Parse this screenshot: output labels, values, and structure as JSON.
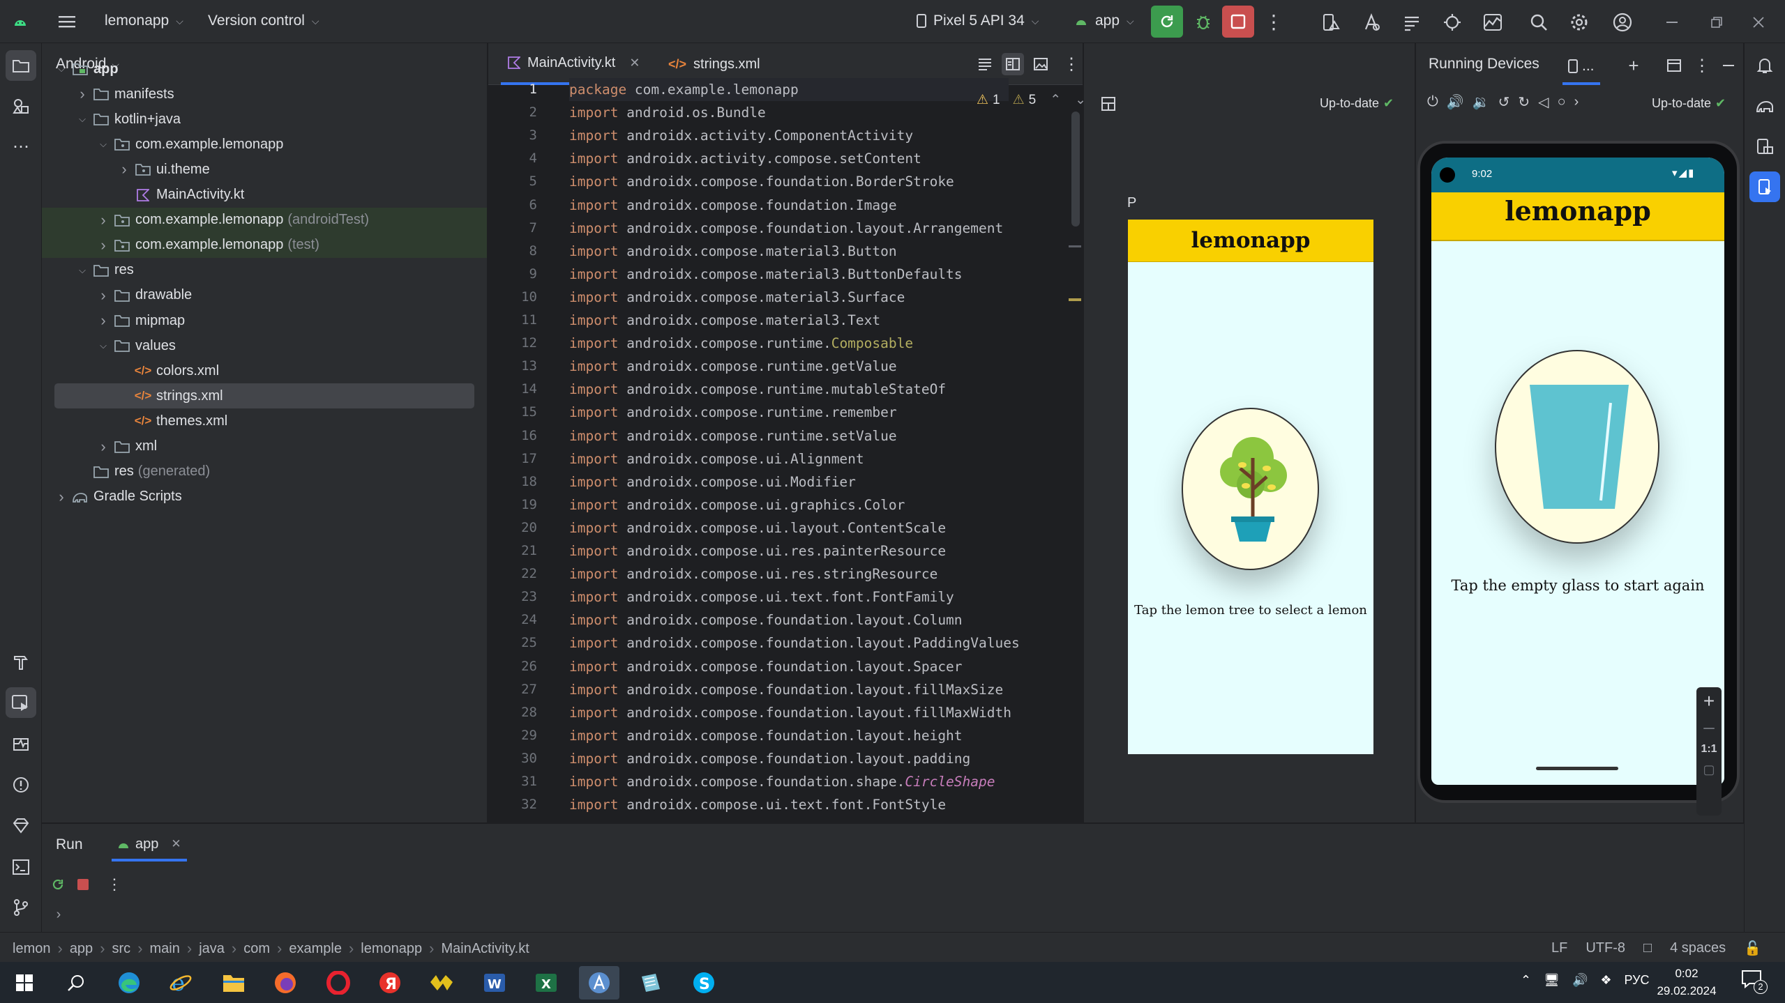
{
  "titlebar": {
    "project": "lemonapp",
    "vcs": "Version control",
    "device": "Pixel 5 API 34",
    "config": "app"
  },
  "project_panel": {
    "view": "Android",
    "tree": [
      {
        "label": "app",
        "depth": 0,
        "arrow": "open",
        "icon": "module",
        "bold": true
      },
      {
        "label": "manifests",
        "depth": 1,
        "arrow": "closed",
        "icon": "folder"
      },
      {
        "label": "kotlin+java",
        "depth": 1,
        "arrow": "open",
        "icon": "folder"
      },
      {
        "label": "com.example.lemonapp",
        "depth": 2,
        "arrow": "open",
        "icon": "package"
      },
      {
        "label": "ui.theme",
        "depth": 3,
        "arrow": "closed",
        "icon": "package"
      },
      {
        "label": "MainActivity.kt",
        "depth": 3,
        "arrow": "none",
        "icon": "kotlin"
      },
      {
        "label": "com.example.lemonapp",
        "suffix": "(androidTest)",
        "depth": 2,
        "arrow": "closed",
        "icon": "package",
        "green": true
      },
      {
        "label": "com.example.lemonapp",
        "suffix": "(test)",
        "depth": 2,
        "arrow": "closed",
        "icon": "package",
        "green": true
      },
      {
        "label": "res",
        "depth": 1,
        "arrow": "open",
        "icon": "folder"
      },
      {
        "label": "drawable",
        "depth": 2,
        "arrow": "closed",
        "icon": "folder"
      },
      {
        "label": "mipmap",
        "depth": 2,
        "arrow": "closed",
        "icon": "folder"
      },
      {
        "label": "values",
        "depth": 2,
        "arrow": "open",
        "icon": "folder"
      },
      {
        "label": "colors.xml",
        "depth": 3,
        "arrow": "none",
        "icon": "xml"
      },
      {
        "label": "strings.xml",
        "depth": 3,
        "arrow": "none",
        "icon": "xml",
        "selected": true
      },
      {
        "label": "themes.xml",
        "depth": 3,
        "arrow": "none",
        "icon": "xml"
      },
      {
        "label": "xml",
        "depth": 2,
        "arrow": "closed",
        "icon": "folder"
      },
      {
        "label": "res",
        "suffix": "(generated)",
        "depth": 1,
        "arrow": "none",
        "icon": "folder"
      },
      {
        "label": "Gradle Scripts",
        "depth": 0,
        "arrow": "closed",
        "icon": "gradle"
      }
    ]
  },
  "editor": {
    "tabs": [
      {
        "label": "MainActivity.kt",
        "active": true
      },
      {
        "label": "strings.xml",
        "active": false
      }
    ],
    "warnings": "1",
    "weak_warnings": "5",
    "lines": [
      [
        "package",
        " com.example.lemonapp"
      ],
      [
        "import",
        " android.os.Bundle"
      ],
      [
        "import",
        " androidx.activity.ComponentActivity"
      ],
      [
        "import",
        " androidx.activity.compose.setContent"
      ],
      [
        "import",
        " androidx.compose.foundation.BorderStroke"
      ],
      [
        "import",
        " androidx.compose.foundation.Image"
      ],
      [
        "import",
        " androidx.compose.foundation.layout.Arrangement"
      ],
      [
        "import",
        " androidx.compose.material3.Button"
      ],
      [
        "import",
        " androidx.compose.material3.ButtonDefaults"
      ],
      [
        "import",
        " androidx.compose.material3.Surface"
      ],
      [
        "import",
        " androidx.compose.material3.Text"
      ],
      [
        "import",
        " androidx.compose.runtime.",
        "Composable"
      ],
      [
        "import",
        " androidx.compose.runtime.getValue"
      ],
      [
        "import",
        " androidx.compose.runtime.mutableStateOf"
      ],
      [
        "import",
        " androidx.compose.runtime.remember"
      ],
      [
        "import",
        " androidx.compose.runtime.setValue"
      ],
      [
        "import",
        " androidx.compose.ui.Alignment"
      ],
      [
        "import",
        " androidx.compose.ui.Modifier"
      ],
      [
        "import",
        " androidx.compose.ui.graphics.Color"
      ],
      [
        "import",
        " androidx.compose.ui.layout.ContentScale"
      ],
      [
        "import",
        " androidx.compose.ui.res.painterResource"
      ],
      [
        "import",
        " androidx.compose.ui.res.stringResource"
      ],
      [
        "import",
        " androidx.compose.ui.text.font.FontFamily"
      ],
      [
        "import",
        " androidx.compose.foundation.layout.Column"
      ],
      [
        "import",
        " androidx.compose.foundation.layout.PaddingValues"
      ],
      [
        "import",
        " androidx.compose.foundation.layout.Spacer"
      ],
      [
        "import",
        " androidx.compose.foundation.layout.fillMaxSize"
      ],
      [
        "import",
        " androidx.compose.foundation.layout.fillMaxWidth"
      ],
      [
        "import",
        " androidx.compose.foundation.layout.height"
      ],
      [
        "import",
        " androidx.compose.foundation.layout.padding"
      ],
      [
        "import",
        " androidx.compose.foundation.shape.",
        "CircleShape"
      ],
      [
        "import",
        " androidx.compose.ui.text.font.FontStyle"
      ]
    ]
  },
  "preview": {
    "status": "Up-to-date",
    "label": "P",
    "app_title": "lemonapp",
    "caption": "Tap the lemon tree to select a lemon"
  },
  "devices": {
    "title": "Running Devices",
    "tab": "...",
    "status": "Up-to-date",
    "time": "9:02",
    "app_title": "lemonapp",
    "caption": "Tap the empty glass to start again",
    "zoom": "1:1"
  },
  "run_panel": {
    "title": "Run",
    "tab": "app"
  },
  "breadcrumbs": [
    "lemon",
    "app",
    "src",
    "main",
    "java",
    "com",
    "example",
    "lemonapp",
    "MainActivity.kt"
  ],
  "status": {
    "line_sep": "LF",
    "encoding": "UTF-8",
    "indent": "4 spaces"
  },
  "taskbar": {
    "lang": "РУС",
    "time": "0:02",
    "date": "29.02.2024",
    "notifications": "2"
  },
  "colors": {
    "accent": "#3574f0",
    "app_bar": "#f9d000",
    "app_bg": "#e6fefe",
    "image_bg": "#fffde0",
    "glass": "#5ec3d0"
  }
}
